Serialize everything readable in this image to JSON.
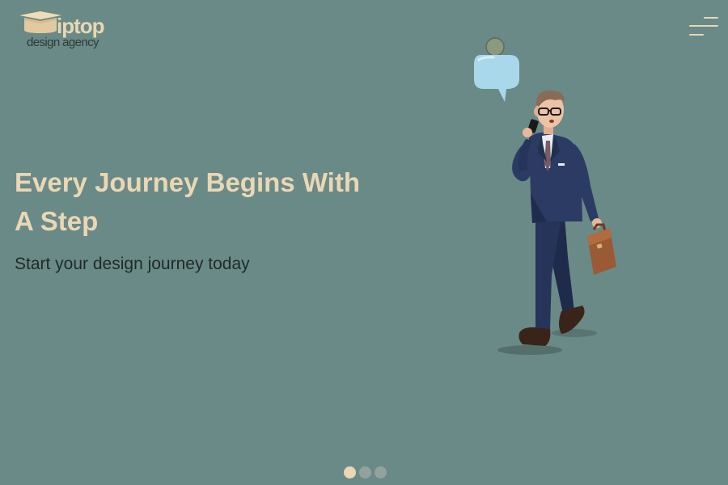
{
  "logo": {
    "wordmark": "iptop",
    "subtitle": "design agency",
    "icon": "graduation-cap-icon"
  },
  "menu": {
    "icon": "hamburger-menu-icon"
  },
  "hero": {
    "title": "Every Journey Begins With A Step",
    "subtitle": "Start your design journey today",
    "illustration": "businessman-walking-on-phone-illustration"
  },
  "slider": {
    "slides": 3,
    "active_index": 0
  },
  "colors": {
    "background": "#6a8a87",
    "accent": "#ead7b4",
    "text_dark": "#1f2a29",
    "dot_inactive": "#92a39d",
    "speech_bubble": "#a8d8ea",
    "suit": "#26345a"
  }
}
